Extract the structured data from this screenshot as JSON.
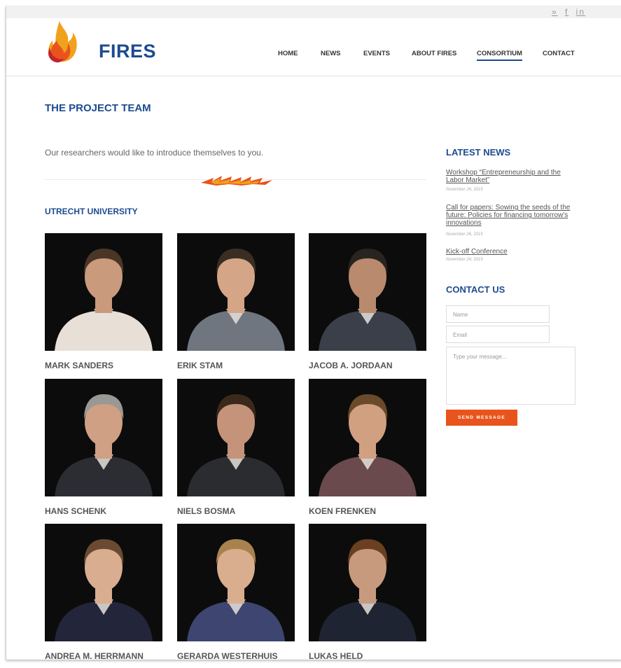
{
  "social": {
    "twitter": "»",
    "facebook": "f",
    "linkedin": "in"
  },
  "brand": {
    "logo_text": "FIRES",
    "primary": "#1d4b8f",
    "accent": "#e8541b"
  },
  "nav": {
    "items": [
      "HOME",
      "NEWS",
      "EVENTS",
      "ABOUT FIRES",
      "CONSORTIUM",
      "CONTACT"
    ],
    "active": "CONSORTIUM"
  },
  "page": {
    "title": "THE PROJECT TEAM",
    "intro": "Our researchers would like to introduce themselves to you.",
    "section": "UTRECHT UNIVERSITY"
  },
  "team": [
    {
      "name": "MARK SANDERS"
    },
    {
      "name": "ERIK STAM"
    },
    {
      "name": "JACOB A. JORDAAN"
    },
    {
      "name": "HANS SCHENK"
    },
    {
      "name": "NIELS BOSMA"
    },
    {
      "name": "KOEN FRENKEN"
    },
    {
      "name": "ANDREA M. HERRMANN"
    },
    {
      "name": "GERARDA WESTERHUIS"
    },
    {
      "name": "LUKAS HELD"
    }
  ],
  "sidebar": {
    "latest_news_title": "LATEST NEWS",
    "news": [
      {
        "title": "Workshop “Entrepreneurship and the Labor Market”",
        "date": "November 26, 2015"
      },
      {
        "title": "Call for papers: Sowing the seeds of the future: Policies for financing tomorrow's innovations",
        "date": "November 26, 2015"
      },
      {
        "title": "Kick-off Conference",
        "date": "November 24, 2015"
      }
    ],
    "contact_title": "CONTACT US",
    "form": {
      "name_placeholder": "Name",
      "email_placeholder": "Email",
      "message_placeholder": "Type your message...",
      "send_label": "SEND MESSAGE"
    }
  }
}
